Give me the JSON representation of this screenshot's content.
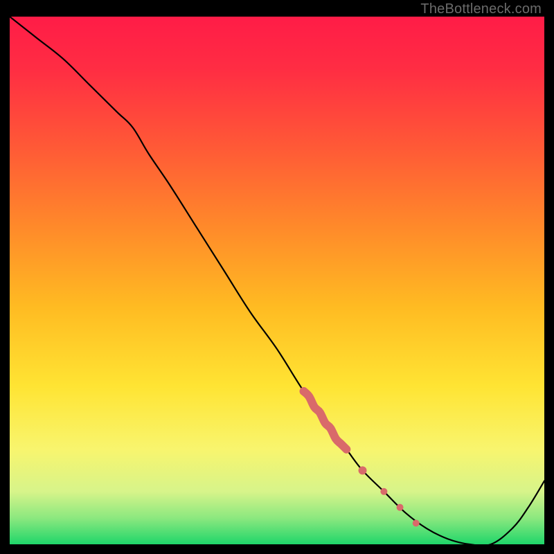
{
  "watermark": "TheBottleneck.com",
  "chart_data": {
    "type": "line",
    "title": "",
    "xlabel": "",
    "ylabel": "",
    "xlim": [
      0,
      100
    ],
    "ylim": [
      0,
      100
    ],
    "series": [
      {
        "name": "bottleneck-curve",
        "x": [
          0,
          5,
          10,
          15,
          20,
          23,
          26,
          30,
          35,
          40,
          45,
          50,
          55,
          60,
          63,
          66,
          70,
          74,
          78,
          82,
          86,
          90,
          94,
          97,
          100
        ],
        "y": [
          100,
          96,
          92,
          87,
          82,
          79,
          74,
          68,
          60,
          52,
          44,
          37,
          29,
          22,
          18,
          14,
          10,
          6,
          3,
          1,
          0,
          0,
          3,
          7,
          12
        ]
      }
    ],
    "highlight_points": {
      "name": "marked-region",
      "color": "#d96a6a",
      "x": [
        55,
        56,
        57,
        58,
        59,
        60,
        61,
        62,
        63,
        66,
        70,
        73,
        76
      ],
      "y": [
        29,
        28,
        26,
        25,
        23,
        22,
        20,
        19,
        18,
        14,
        10,
        7,
        4
      ]
    },
    "background_gradient": {
      "stops": [
        {
          "offset": 0.0,
          "color": "#ff1c47"
        },
        {
          "offset": 0.1,
          "color": "#ff2d43"
        },
        {
          "offset": 0.25,
          "color": "#ff5a36"
        },
        {
          "offset": 0.4,
          "color": "#ff8a2a"
        },
        {
          "offset": 0.55,
          "color": "#ffbb22"
        },
        {
          "offset": 0.7,
          "color": "#ffe433"
        },
        {
          "offset": 0.82,
          "color": "#f8f56e"
        },
        {
          "offset": 0.9,
          "color": "#d7f48a"
        },
        {
          "offset": 0.95,
          "color": "#8ce87f"
        },
        {
          "offset": 1.0,
          "color": "#1fd66a"
        }
      ]
    }
  }
}
